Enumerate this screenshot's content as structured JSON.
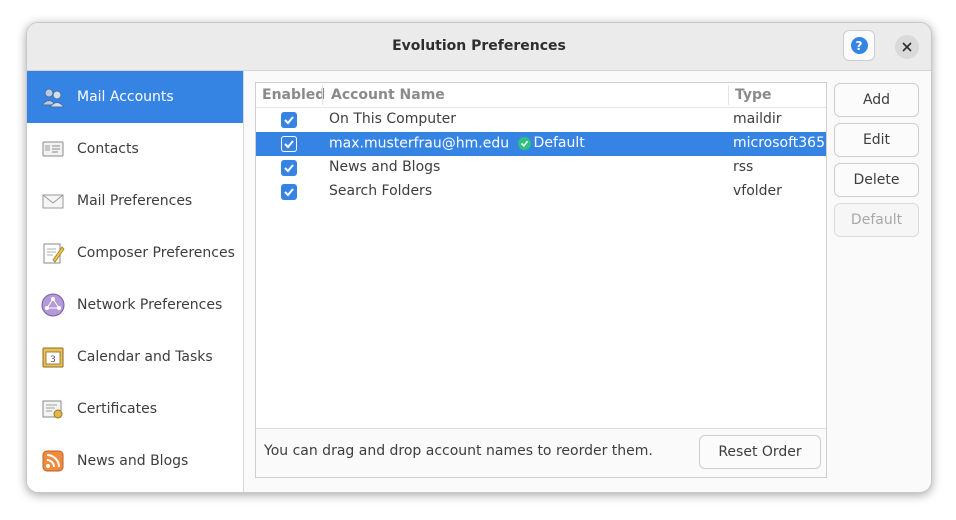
{
  "window": {
    "title": "Evolution Preferences"
  },
  "sidebar": {
    "items": [
      {
        "label": "Mail Accounts",
        "icon": "accounts-icon",
        "selected": true
      },
      {
        "label": "Contacts",
        "icon": "contacts-icon"
      },
      {
        "label": "Mail Preferences",
        "icon": "mail-icon"
      },
      {
        "label": "Composer Preferences",
        "icon": "composer-icon"
      },
      {
        "label": "Network Preferences",
        "icon": "network-icon"
      },
      {
        "label": "Calendar and Tasks",
        "icon": "calendar-icon"
      },
      {
        "label": "Certificates",
        "icon": "certificate-icon"
      },
      {
        "label": "News and Blogs",
        "icon": "rss-icon"
      }
    ]
  },
  "accounts": {
    "columns": {
      "enabled": "Enabled",
      "name": "Account Name",
      "type": "Type"
    },
    "rows": [
      {
        "name": "On This Computer",
        "type": "maildir",
        "enabled": true
      },
      {
        "name": "max.musterfrau@hm.edu",
        "default_label": "Default",
        "type": "microsoft365",
        "enabled": true,
        "selected": true
      },
      {
        "name": "News and Blogs",
        "type": "rss",
        "enabled": true
      },
      {
        "name": "Search Folders",
        "type": "vfolder",
        "enabled": true
      }
    ],
    "hint": "You can drag and drop account names to reorder them.",
    "reset_label": "Reset Order"
  },
  "actions": {
    "add": "Add",
    "edit": "Edit",
    "delete": "Delete",
    "default": "Default"
  },
  "colors": {
    "accent": "#3584e4",
    "ok": "#2ec27e"
  }
}
